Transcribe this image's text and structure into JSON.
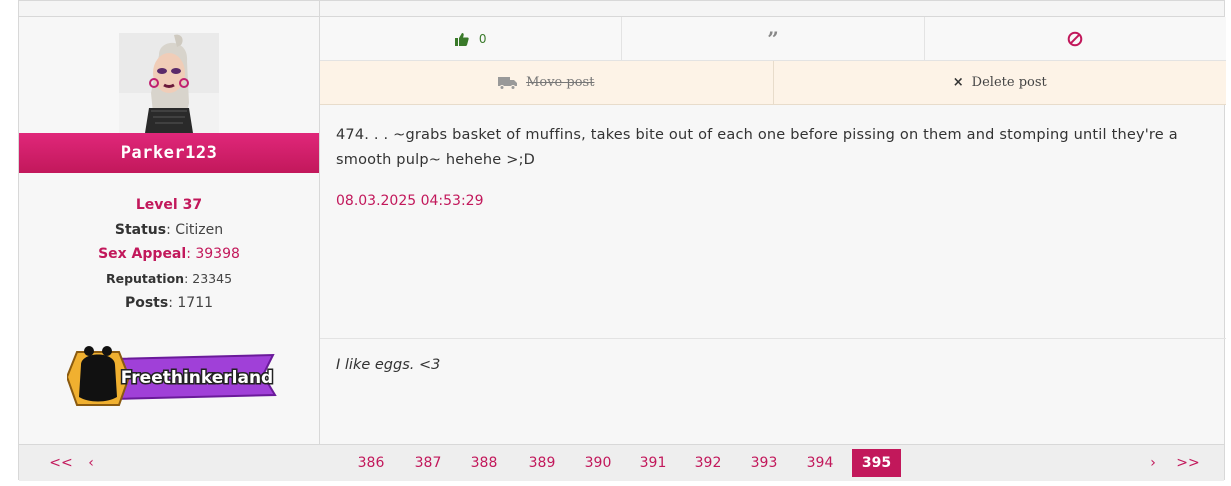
{
  "user": {
    "name": "Parker123",
    "level": "Level 37",
    "status_label": "Status",
    "status_value": "Citizen",
    "sex_appeal_label": "Sex Appeal",
    "sex_appeal_value": "39398",
    "reputation_label": "Reputation",
    "reputation_value": "23345",
    "posts_label": "Posts",
    "posts_value": "1711",
    "badge_text": "Freethinkerland"
  },
  "actions": {
    "likes": "0",
    "move_post": "Move post",
    "delete_post": "Delete post"
  },
  "post": {
    "message": "474. . . ~grabs basket of muffins, takes bite out of each one before pissing on them and stomping until they're a smooth pulp~ hehehe >;D",
    "date": "08.03.2025 04:53:29",
    "signature": "I like eggs. <3"
  },
  "pagination": {
    "first": "<<",
    "prev": "‹",
    "pages": [
      "386",
      "387",
      "388",
      "389",
      "390",
      "391",
      "392",
      "393",
      "394"
    ],
    "current": "395",
    "next": "›",
    "last": ">>"
  },
  "colors": {
    "accent": "#c2185b",
    "like_green": "#3a7a2a",
    "mod_bg": "#fdf3e7"
  }
}
